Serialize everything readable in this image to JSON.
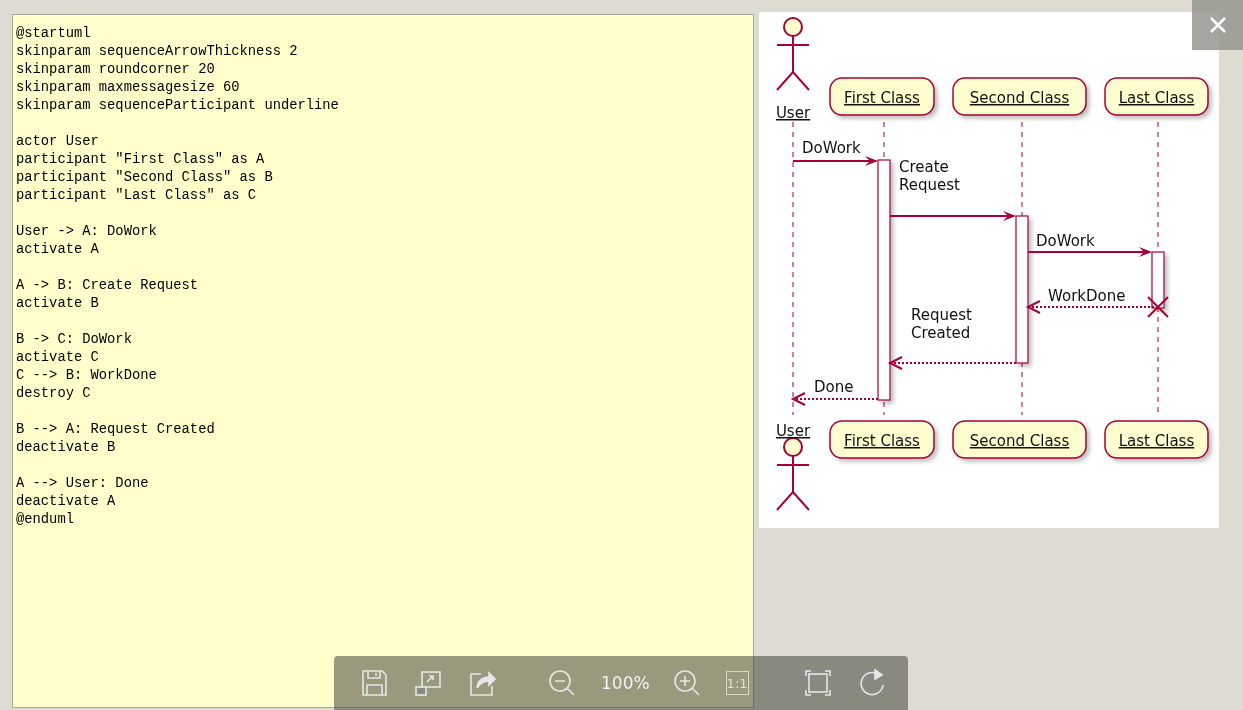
{
  "editor": {
    "blocks": [
      [
        "@startuml",
        "skinparam sequenceArrowThickness 2",
        "skinparam roundcorner 20",
        "skinparam maxmessagesize 60",
        "skinparam sequenceParticipant underline"
      ],
      [
        "actor User",
        "participant \"First Class\" as A",
        "participant \"Second Class\" as B",
        "participant \"Last Class\" as C"
      ],
      [
        "User -> A: DoWork",
        "activate A"
      ],
      [
        "A -> B: Create Request",
        "activate B"
      ],
      [
        "B -> C: DoWork",
        "activate C",
        "C --> B: WorkDone",
        "destroy C"
      ],
      [
        "B --> A: Request Created",
        "deactivate B"
      ],
      [
        "A --> User: Done",
        "deactivate A",
        "@enduml"
      ]
    ]
  },
  "diagram": {
    "participants": [
      {
        "kind": "actor",
        "head": "User",
        "foot": "User",
        "destroyed": false
      },
      {
        "kind": "participant",
        "head": "First Class",
        "foot": "First Class",
        "destroyed": false
      },
      {
        "kind": "participant",
        "head": "Second Class",
        "foot": "Second Class",
        "destroyed": false
      },
      {
        "kind": "participant",
        "head": "Last Class",
        "foot": "Last Class",
        "destroyed": true
      }
    ],
    "messages": [
      {
        "kind": "sync",
        "label_lines": [
          "DoWork"
        ]
      },
      {
        "kind": "sync",
        "label_lines": [
          "Create",
          "Request"
        ]
      },
      {
        "kind": "sync",
        "label_lines": [
          "DoWork"
        ]
      },
      {
        "kind": "return",
        "label_lines": [
          "WorkDone"
        ]
      },
      {
        "kind": "return",
        "label_lines": [
          "Request",
          "Created"
        ]
      },
      {
        "kind": "return",
        "label_lines": [
          "Done"
        ]
      }
    ]
  },
  "toolbar": {
    "zoom": "100%",
    "actual_size": {
      "label": "1:1",
      "disabled": true
    }
  }
}
